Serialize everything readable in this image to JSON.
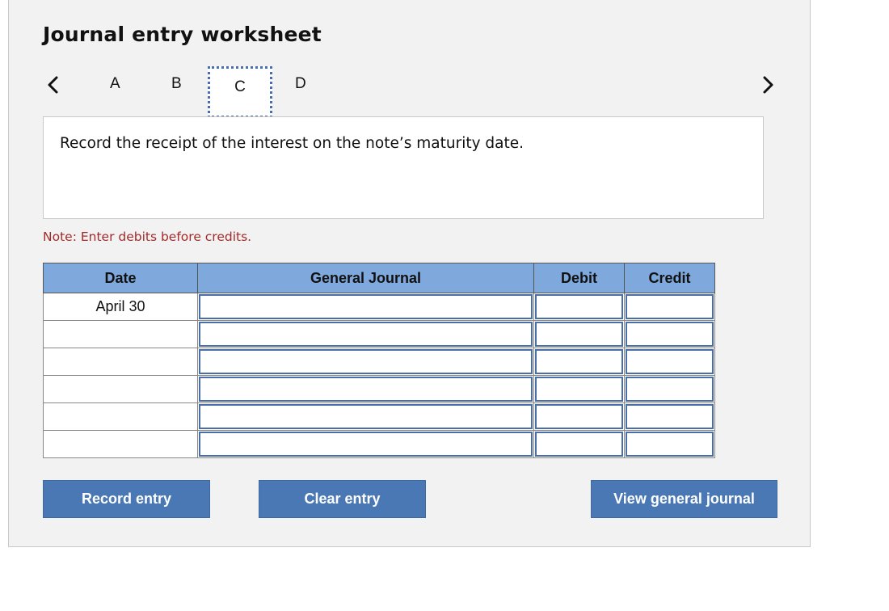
{
  "title": "Journal entry worksheet",
  "steps": [
    "A",
    "B",
    "C",
    "D"
  ],
  "active_step": "C",
  "instruction": "Record the receipt of the interest on the note’s maturity date.",
  "note": "Note: Enter debits before credits.",
  "table": {
    "headers": {
      "date": "Date",
      "journal": "General Journal",
      "debit": "Debit",
      "credit": "Credit"
    },
    "rows": [
      {
        "date": "April 30",
        "journal": "",
        "debit": "",
        "credit": ""
      },
      {
        "date": "",
        "journal": "",
        "debit": "",
        "credit": ""
      },
      {
        "date": "",
        "journal": "",
        "debit": "",
        "credit": ""
      },
      {
        "date": "",
        "journal": "",
        "debit": "",
        "credit": ""
      },
      {
        "date": "",
        "journal": "",
        "debit": "",
        "credit": ""
      },
      {
        "date": "",
        "journal": "",
        "debit": "",
        "credit": ""
      }
    ]
  },
  "buttons": {
    "record": "Record entry",
    "clear": "Clear entry",
    "view": "View general journal"
  },
  "colors": {
    "header_bg": "#7fa8dd",
    "button_bg": "#4a78b5",
    "note_text": "#a52a2a",
    "input_border": "#4a6fa8"
  },
  "icons": {
    "prev": "chevron-left-icon",
    "next": "chevron-right-icon"
  }
}
